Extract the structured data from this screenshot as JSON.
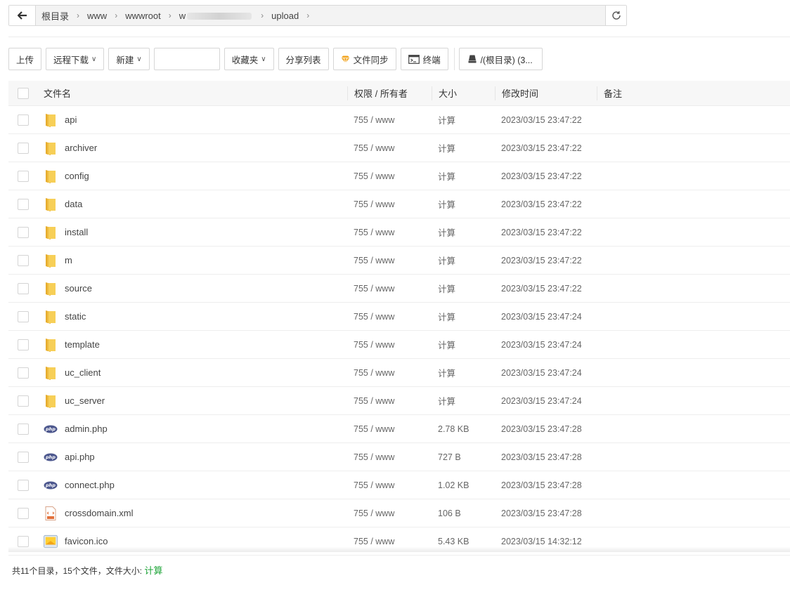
{
  "breadcrumb": {
    "items": [
      "根目录",
      "www",
      "wwwroot",
      "w",
      "upload"
    ]
  },
  "toolbar": {
    "upload": "上传",
    "remote_download": "远程下载",
    "new": "新建",
    "favorites": "收藏夹",
    "share_list": "分享列表",
    "file_sync": "文件同步",
    "terminal": "终端",
    "disk": "/(根目录) (3..."
  },
  "table": {
    "headers": {
      "name": "文件名",
      "perm": "权限 / 所有者",
      "size": "大小",
      "mtime": "修改时间",
      "note": "备注"
    },
    "rows": [
      {
        "type": "folder",
        "name": "api",
        "perm": "755 / www",
        "size": "计算",
        "mtime": "2023/03/15 23:47:22"
      },
      {
        "type": "folder",
        "name": "archiver",
        "perm": "755 / www",
        "size": "计算",
        "mtime": "2023/03/15 23:47:22"
      },
      {
        "type": "folder",
        "name": "config",
        "perm": "755 / www",
        "size": "计算",
        "mtime": "2023/03/15 23:47:22"
      },
      {
        "type": "folder",
        "name": "data",
        "perm": "755 / www",
        "size": "计算",
        "mtime": "2023/03/15 23:47:22"
      },
      {
        "type": "folder",
        "name": "install",
        "perm": "755 / www",
        "size": "计算",
        "mtime": "2023/03/15 23:47:22"
      },
      {
        "type": "folder",
        "name": "m",
        "perm": "755 / www",
        "size": "计算",
        "mtime": "2023/03/15 23:47:22"
      },
      {
        "type": "folder",
        "name": "source",
        "perm": "755 / www",
        "size": "计算",
        "mtime": "2023/03/15 23:47:22"
      },
      {
        "type": "folder",
        "name": "static",
        "perm": "755 / www",
        "size": "计算",
        "mtime": "2023/03/15 23:47:24"
      },
      {
        "type": "folder",
        "name": "template",
        "perm": "755 / www",
        "size": "计算",
        "mtime": "2023/03/15 23:47:24"
      },
      {
        "type": "folder",
        "name": "uc_client",
        "perm": "755 / www",
        "size": "计算",
        "mtime": "2023/03/15 23:47:24"
      },
      {
        "type": "folder",
        "name": "uc_server",
        "perm": "755 / www",
        "size": "计算",
        "mtime": "2023/03/15 23:47:24"
      },
      {
        "type": "php",
        "name": "admin.php",
        "perm": "755 / www",
        "size": "2.78 KB",
        "mtime": "2023/03/15 23:47:28"
      },
      {
        "type": "php",
        "name": "api.php",
        "perm": "755 / www",
        "size": "727 B",
        "mtime": "2023/03/15 23:47:28"
      },
      {
        "type": "php",
        "name": "connect.php",
        "perm": "755 / www",
        "size": "1.02 KB",
        "mtime": "2023/03/15 23:47:28"
      },
      {
        "type": "xml",
        "name": "crossdomain.xml",
        "perm": "755 / www",
        "size": "106 B",
        "mtime": "2023/03/15 23:47:28"
      },
      {
        "type": "ico",
        "name": "favicon.ico",
        "perm": "755 / www",
        "size": "5.43 KB",
        "mtime": "2023/03/15 14:32:12"
      }
    ]
  },
  "footer": {
    "summary": "共11个目录，15个文件，文件大小: ",
    "calc": "计算"
  },
  "colors": {
    "accent_green": "#20a53a",
    "folder_yellow": "#f5c542"
  }
}
